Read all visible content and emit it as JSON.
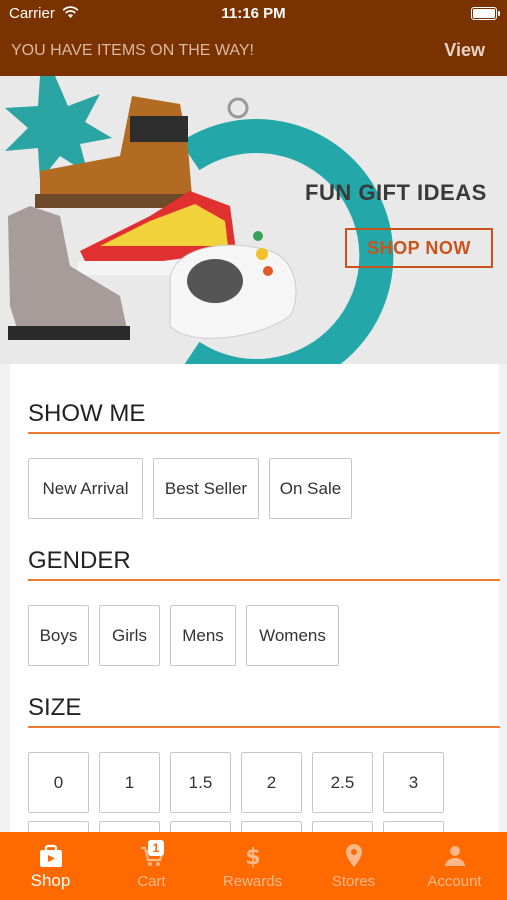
{
  "status_bar": {
    "carrier": "Carrier",
    "time": "11:16 PM"
  },
  "notice": {
    "message": "YOU HAVE ITEMS ON THE WAY!",
    "action": "View"
  },
  "banner": {
    "headline": "FUN GIFT IDEAS",
    "cta": "SHOP NOW"
  },
  "filters": {
    "show_me": {
      "title": "SHOW ME",
      "options": [
        "New Arrival",
        "Best Seller",
        "On Sale"
      ]
    },
    "gender": {
      "title": "GENDER",
      "options": [
        "Boys",
        "Girls",
        "Mens",
        "Womens"
      ]
    },
    "size": {
      "title": "SIZE",
      "options": [
        "0",
        "1",
        "1.5",
        "2",
        "2.5",
        "3"
      ]
    }
  },
  "tabs": [
    {
      "label": "Shop",
      "icon": "shopping-bag-icon",
      "active": true
    },
    {
      "label": "Cart",
      "icon": "cart-icon",
      "badge": "1"
    },
    {
      "label": "Rewards",
      "icon": "dollar-icon"
    },
    {
      "label": "Stores",
      "icon": "location-pin-icon"
    },
    {
      "label": "Account",
      "icon": "user-icon"
    }
  ],
  "colors": {
    "brand_orange": "#ff6a00",
    "header_brown": "#7a3300",
    "accent_line": "#ee7a30"
  }
}
